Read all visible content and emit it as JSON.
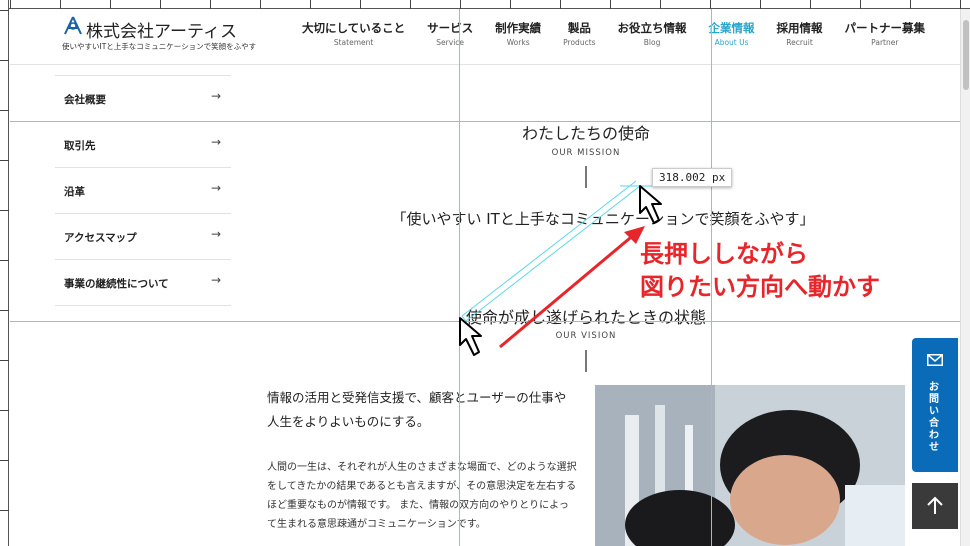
{
  "header": {
    "logo_name": "株式会社アーティス",
    "logo_tagline": "使いやすいITと上手なコミュニケーションで笑顔をふやす",
    "nav": [
      {
        "jp": "大切にしていること",
        "en": "Statement"
      },
      {
        "jp": "サービス",
        "en": "Service"
      },
      {
        "jp": "制作実績",
        "en": "Works"
      },
      {
        "jp": "製品",
        "en": "Products"
      },
      {
        "jp": "お役立ち情報",
        "en": "Blog"
      },
      {
        "jp": "企業情報",
        "en": "About Us"
      },
      {
        "jp": "採用情報",
        "en": "Recruit"
      },
      {
        "jp": "パートナー募集",
        "en": "Partner"
      }
    ],
    "active_index": 5
  },
  "sidebar": {
    "items": [
      {
        "label": "会社概要",
        "arrow": "→"
      },
      {
        "label": "取引先",
        "arrow": "→"
      },
      {
        "label": "沿革",
        "arrow": "→"
      },
      {
        "label": "アクセスマップ",
        "arrow": "→"
      },
      {
        "label": "事業の継続性について",
        "arrow": "→"
      }
    ]
  },
  "mission": {
    "title": "わたしたちの使命",
    "subtitle": "OUR MISSION",
    "text": "「使いやすい ITと上手なコミュニケーションで笑顔をふやす」"
  },
  "vision": {
    "title": "使命が成し遂げられたときの状態",
    "subtitle": "OUR VISION",
    "lead": "情報の活用と受発信支援で、顧客とユーザーの仕事や人生をよりよいものにする。",
    "body": "人間の一生は、それぞれが人生のさまざまな場面で、どのような選択をしてきたかの結果であるとも言えますが、その意思決定を左右するほど重要なものが情報です。 また、情報の双方向のやりとりによって生まれる意思疎通がコミュニケーションです。"
  },
  "measurement": {
    "label": "318.002 px"
  },
  "annotation": {
    "line1": "長押ししながら",
    "line2": "図りたい方向へ動かす"
  },
  "floating": {
    "contact_label": "お問い合わせ",
    "contact_icon": "mail-icon",
    "top_icon": "arrow-up-icon"
  },
  "colors": {
    "accent": "#29a6c9",
    "guide": "#5fd6e8",
    "annotation": "#e8252a",
    "contact": "#0a6bb8",
    "top_button": "#3a3a3a"
  }
}
